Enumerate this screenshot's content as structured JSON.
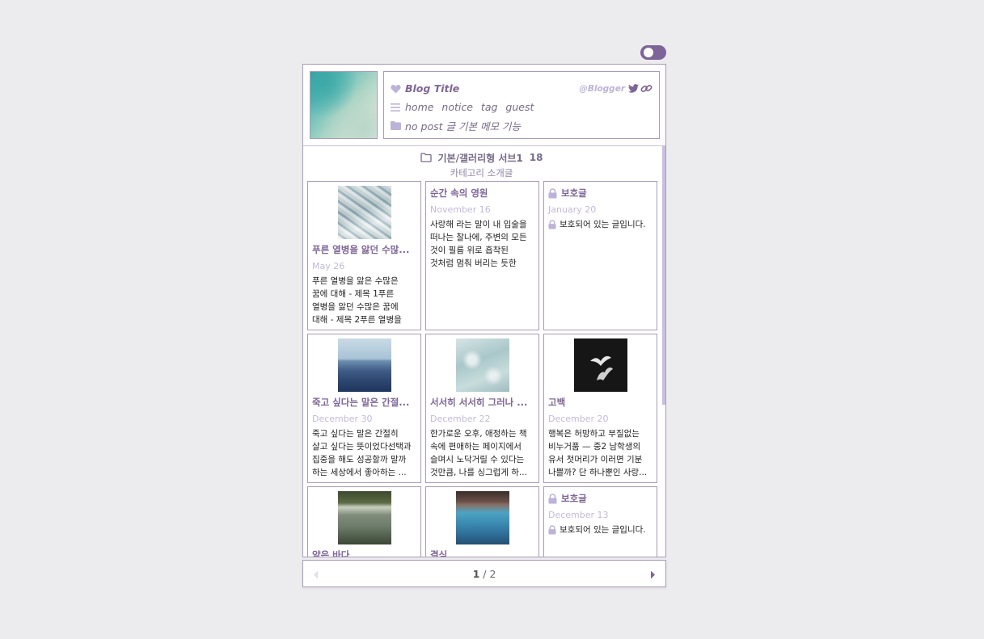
{
  "header": {
    "blog_title": "Blog Title",
    "blogger": "@Blogger",
    "nav": [
      "home",
      "notice",
      "tag",
      "guest"
    ],
    "post_info": "no post 글 기본 메모 기능"
  },
  "category": {
    "title": "기본/갤러리형 서브1",
    "count": "18",
    "description": "카테고리 소개글"
  },
  "posts": [
    {
      "title": "푸른 열병을 앓던 수많...",
      "date": "May 26",
      "excerpt": "푸른 열병을 앓은 수많은 꿈에 대해 - 제목 1푸른 열병을 앓던 수많은 꿈에 대해 - 제목 2푸른 열병을 앓던 수...",
      "image": "ice"
    },
    {
      "title": "순간 속의 영원",
      "date": "November 16",
      "excerpt": "사랑해 라는 말이 내 입술을 떠나는 찰나에, 주변의 모든 것이 필름 위로 흡착된 것처럼 멈춰 버리는 듯한 느낌..."
    },
    {
      "title": "보호글",
      "date": "January 20",
      "excerpt": "보호되어 있는 글입니다.",
      "locked": true
    },
    {
      "title": "죽고 싶다는 말은 간절...",
      "date": "December 30",
      "excerpt": "죽고 싶다는 말은 간절히 살고 싶다는 뜻이었다선택과 집중을 해도 성공할까 말까 하는 세상에서 좋아하는 ...",
      "image": "sea"
    },
    {
      "title": "서서히 서서히 그러나 ...",
      "date": "December 22",
      "excerpt": "한가로운 오후, 애정하는 책 속에 편애하는 페이지에서 슬며시 노닥거릴 수 있다는 것만큼, 나를 싱그럽게 하...",
      "image": "water"
    },
    {
      "title": "고백",
      "date": "December 20",
      "excerpt": "행복은 허망하고 부질없는 비누거품 — 중2 남학생의 유서 첫머리가 이러면 기분 나쁠까? 단 하나뿐인 사랑...",
      "image": "birds"
    },
    {
      "title": "얕은 바다",
      "date": "",
      "excerpt": "",
      "image": "shore"
    },
    {
      "title": "결심",
      "date": "",
      "excerpt": "",
      "image": "pool"
    },
    {
      "title": "보호글",
      "date": "December 13",
      "excerpt": "보호되어 있는 글입니다.",
      "locked": true
    }
  ],
  "pagination": {
    "current": "1",
    "separator": "/",
    "total": "2"
  },
  "colors": {
    "accent": "#7e6597",
    "light_accent": "#bdb2d7",
    "border": "#a89bb9",
    "background": "#ecebee"
  }
}
